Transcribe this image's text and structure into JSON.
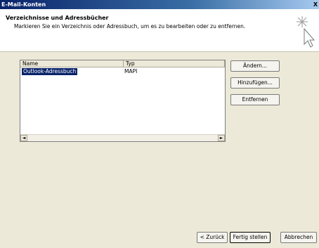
{
  "window": {
    "title": "E-Mail-Konten",
    "close_label": "X"
  },
  "header": {
    "title": "Verzeichnisse und Adressbücher",
    "description": "Markieren Sie ein Verzeichnis oder Adressbuch, um es zu bearbeiten oder zu entfernen.",
    "icon": "wizard-cursor-icon"
  },
  "list": {
    "columns": [
      "Name",
      "Typ"
    ],
    "rows": [
      {
        "name": "Outlook-Adressbuch",
        "type": "MAPI",
        "selected": true
      }
    ]
  },
  "side_buttons": {
    "change": "Ändern...",
    "add": "Hinzufügen...",
    "remove": "Entfernen"
  },
  "footer_buttons": {
    "back": "< Zurück",
    "finish": "Fertig stellen",
    "cancel": "Abbrechen"
  },
  "scrollbar": {
    "left_arrow": "◄",
    "right_arrow": "►"
  },
  "colors": {
    "title_start": "#0a246a",
    "selection": "#0a246a",
    "dialog_bg": "#ece9d8"
  }
}
